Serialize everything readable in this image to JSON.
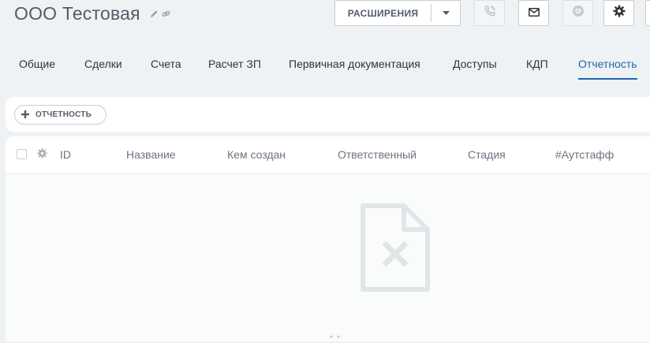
{
  "header": {
    "title": "ООО Тестовая",
    "extensions_label": "РАСШИРЕНИЯ"
  },
  "tabs": [
    {
      "label": "Общие"
    },
    {
      "label": "Сделки"
    },
    {
      "label": "Счета"
    },
    {
      "label": "Расчет ЗП"
    },
    {
      "label": "Первичная документация"
    },
    {
      "label": "Доступы"
    },
    {
      "label": "КДП"
    },
    {
      "label": "Отчетность",
      "active": true
    }
  ],
  "toolbar": {
    "add_label": "ОТЧЕТНОСТЬ"
  },
  "grid": {
    "columns": [
      "ID",
      "Название",
      "Кем создан",
      "Ответственный",
      "Стадия",
      "#Аутстафф"
    ]
  },
  "colors": {
    "accent": "#2067b0",
    "title": "#525c69",
    "background": "#eef2f4"
  },
  "icons": [
    "pencil-icon",
    "link-icon",
    "chevron-down-icon",
    "phone-icon",
    "mail-icon",
    "chat-icon",
    "gear-icon",
    "plus-icon",
    "empty-document-icon"
  ]
}
